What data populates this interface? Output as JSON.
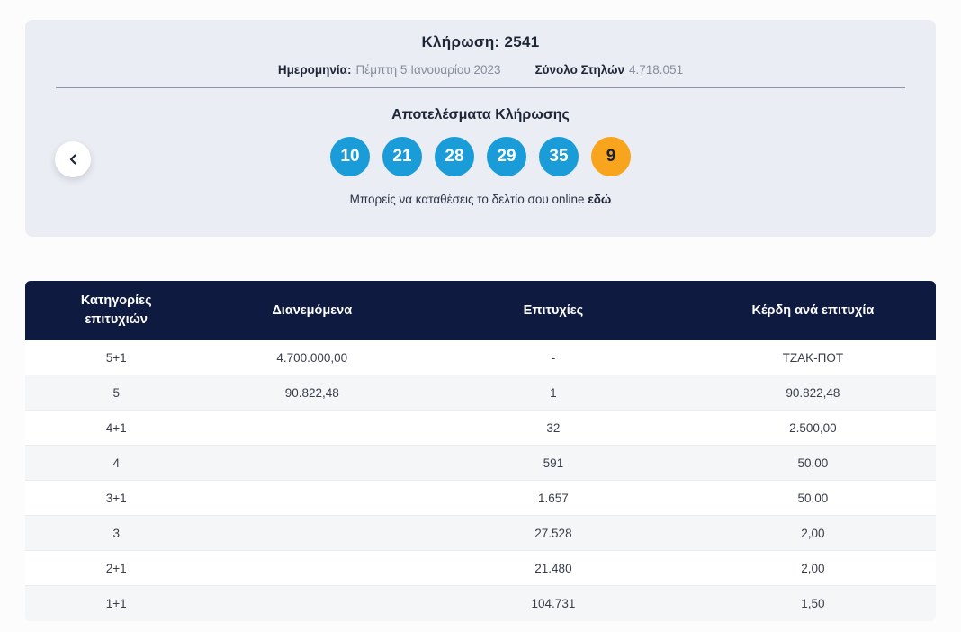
{
  "panel": {
    "title": "Κλήρωση: 2541",
    "date_label": "Ημερομηνία:",
    "date_value": "Πέμπτη 5 Ιανουαρίου 2023",
    "columns_label": "Σύνολο Στηλών",
    "columns_value": "4.718.051",
    "results_title": "Αποτελέσματα Κλήρωσης",
    "numbers": [
      "10",
      "21",
      "28",
      "29",
      "35"
    ],
    "bonus_number": "9",
    "online_text": "Μπορείς να καταθέσεις το δελτίο σου online",
    "online_link_text": "εδώ"
  },
  "nav": {
    "back_icon": "chevron-left"
  },
  "table": {
    "headers": {
      "category": "Κατηγορίες επιτυχιών",
      "distributed": "Διανεμόμενα",
      "winners": "Επιτυχίες",
      "winnings": "Κέρδη ανά επιτυχία"
    },
    "rows": [
      {
        "category": "5+1",
        "distributed": "4.700.000,00",
        "winners": "-",
        "winnings": "ΤΖΑΚ-ΠΟΤ"
      },
      {
        "category": "5",
        "distributed": "90.822,48",
        "winners": "1",
        "winnings": "90.822,48"
      },
      {
        "category": "4+1",
        "distributed": "",
        "winners": "32",
        "winnings": "2.500,00"
      },
      {
        "category": "4",
        "distributed": "",
        "winners": "591",
        "winnings": "50,00"
      },
      {
        "category": "3+1",
        "distributed": "",
        "winners": "1.657",
        "winnings": "50,00"
      },
      {
        "category": "3",
        "distributed": "",
        "winners": "27.528",
        "winnings": "2,00"
      },
      {
        "category": "2+1",
        "distributed": "",
        "winners": "21.480",
        "winnings": "2,00"
      },
      {
        "category": "1+1",
        "distributed": "",
        "winners": "104.731",
        "winnings": "1,50"
      }
    ]
  },
  "colors": {
    "panel_background": "#eaedf3",
    "ball_blue": "#1a9cd8",
    "ball_bonus_orange": "#f8a41c",
    "table_header_navy": "#0e1a40",
    "muted_text": "#858c9b"
  }
}
